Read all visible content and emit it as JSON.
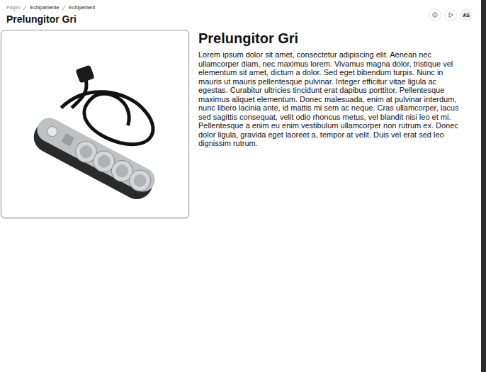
{
  "breadcrumb": [
    {
      "label": "Pagini",
      "current": false
    },
    {
      "label": "Echipamente",
      "current": false
    },
    {
      "label": "Echipement",
      "current": true
    }
  ],
  "page_title": "Prelungitor Gri",
  "header_buttons": [
    {
      "kind": "icon",
      "icon": "info",
      "label": ""
    },
    {
      "kind": "icon",
      "icon": "logout",
      "label": ""
    },
    {
      "kind": "avatar",
      "icon": "",
      "label": "AS"
    }
  ],
  "product": {
    "title": "Prelungitor Gri",
    "description": "Lorem ipsum dolor sit amet, consectetur adipiscing elit. Aenean nec ullamcorper diam, nec maximus lorem. Vivamus magna dolor, tristique vel elementum sit amet, dictum a dolor. Sed eget bibendum turpis. Nunc in mauris ut mauris pellentesque pulvinar. Integer efficitur vitae ligula ac egestas. Curabitur ultricies tincidunt erat dapibus porttitor. Pellentesque maximus aliquet elementum. Donec malesuada, enim at pulvinar interdum, nunc libero lacinia ante, id mattis mi sem ac neque. Cras ullamcorper, lacus sed sagittis consequat, velit odio rhoncus metus, vel blandit nisi leo et mi. Pellentesque a enim eu enim vestibulum ullamcorper non rutrum ex. Donec dolor ligula, gravida eget laoreet a, tempor at velit. Duis vel erat sed leo dignissim rutrum."
  }
}
